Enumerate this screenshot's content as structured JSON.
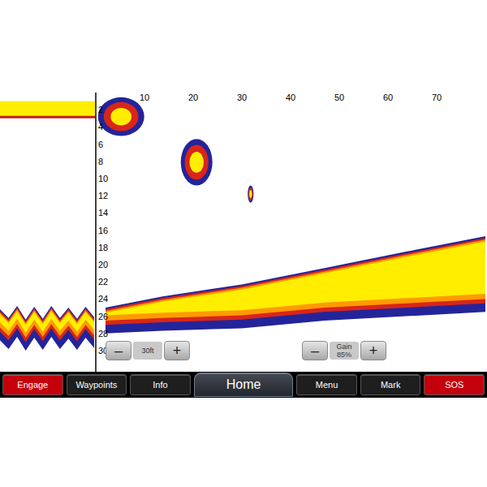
{
  "depth_scale": {
    "ticks": [
      "2",
      "4",
      "6",
      "8",
      "10",
      "12",
      "14",
      "16",
      "18",
      "20",
      "22",
      "24",
      "26",
      "28",
      "30"
    ]
  },
  "range_scale": {
    "ticks": [
      "10",
      "20",
      "30",
      "40",
      "50",
      "60",
      "70"
    ]
  },
  "history": {
    "surface_band": [
      1.0,
      2.9
    ],
    "bottom": [
      25.6,
      26.6,
      25.2,
      26.8,
      25.3,
      26.7,
      25.2,
      26.6,
      25.4,
      26.7,
      25.3,
      26.5
    ]
  },
  "sonar": {
    "distance": [
      2,
      13.7,
      30,
      47,
      63.7,
      80
    ],
    "bottom_top": [
      25.4,
      24.1,
      22.7,
      20.8,
      18.9,
      17.1
    ],
    "bottom_base": [
      26.2,
      25.9,
      25.6,
      24.7,
      24.2,
      23.7
    ],
    "targets": [
      {
        "distance": 5.2,
        "depth": 2.8,
        "width": 9.5,
        "height": 4.5
      },
      {
        "distance": 20.7,
        "depth": 8.1,
        "width": 6.5,
        "height": 5.4
      },
      {
        "distance": 31.8,
        "depth": 11.8,
        "width": 1.2,
        "height": 2.0
      }
    ]
  },
  "zoom": {
    "minus": "–",
    "label": "30ft",
    "plus": "+"
  },
  "gain": {
    "minus": "–",
    "label": "Gain",
    "value": "85%",
    "plus": "+"
  },
  "buttons": [
    {
      "label": "Engage",
      "kind": "key",
      "color": "#c4000c"
    },
    {
      "label": "Waypoints",
      "kind": "key",
      "color": "#1e1e1e"
    },
    {
      "label": "Info",
      "kind": "key",
      "color": "#1e1e1e"
    },
    {
      "label": "Home",
      "kind": "home",
      "color": "#2a2f3a"
    },
    {
      "label": "Menu",
      "kind": "key",
      "color": "#1e1e1e"
    },
    {
      "label": "Mark",
      "kind": "key",
      "color": "#1e1e1e"
    },
    {
      "label": "SOS",
      "kind": "key",
      "color": "#c4000c"
    }
  ]
}
